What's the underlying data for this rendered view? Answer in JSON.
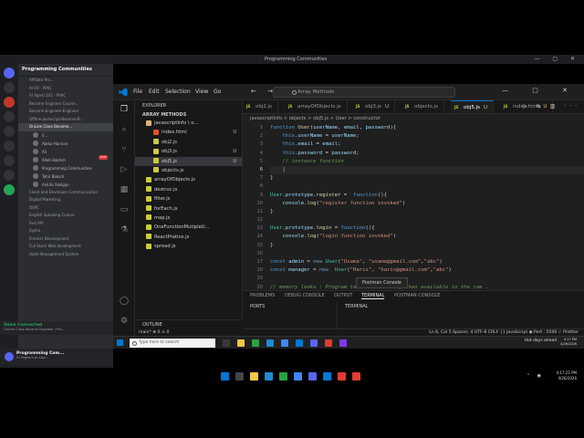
{
  "discord": {
    "window_title": "Programming Communities",
    "server_name": "Programming Communities",
    "channels": [
      "Affiliate Pro...",
      "AI IOI - PIAIC",
      "AI Agent 201 - PIAIC",
      "Become Engineer Course...",
      "Become-Engineer-Engineer",
      "Offline-javascript-Become-B...",
      "OnLine Class Become..."
    ],
    "users": [
      "S...",
      "Abdul Hannan",
      "Ali",
      "Allah Bakhsh",
      "Programming Communities",
      "Tahir Baloch",
      "Ankita Sloligan"
    ],
    "live_label": "LIVE",
    "more_channels": [
      "Client and Developer Communication",
      "Digital Marketing",
      "DSPC",
      "English Speaking Course",
      "Fast API",
      "Figma",
      "Frontier Development",
      "Full Stack Web development",
      "Hotel Management System"
    ],
    "voice_status": "Voice Connected",
    "voice_channel": "OnLine Class Become Engineer / Pro...",
    "me_name": "Programming Com...",
    "me_status": "Hi Pegham Jo Aisa..."
  },
  "vscode": {
    "menu": [
      "File",
      "Edit",
      "Selection",
      "View",
      "Go"
    ],
    "command_center": "Array Methods",
    "explorer_header": "EXPLORER",
    "project_name": "ARRAY METHODS",
    "files": [
      {
        "name": "javascriptInfo \\ o...",
        "mark": "",
        "indent": 1,
        "color": "#dcb67a"
      },
      {
        "name": "index.html",
        "mark": "U",
        "indent": 2,
        "color": "#e44d26"
      },
      {
        "name": "obj2.js",
        "mark": "",
        "indent": 2,
        "color": "#cbcb41"
      },
      {
        "name": "obj3.js",
        "mark": "U",
        "indent": 2,
        "color": "#cbcb41"
      },
      {
        "name": "obj5.js",
        "mark": "U",
        "indent": 2,
        "color": "#cbcb41"
      },
      {
        "name": "objects.js",
        "mark": "",
        "indent": 2,
        "color": "#cbcb41"
      },
      {
        "name": "arrayOfObjects.js",
        "mark": "",
        "indent": 1,
        "color": "#cbcb41"
      },
      {
        "name": "destruc.js",
        "mark": "",
        "indent": 1,
        "color": "#cbcb41"
      },
      {
        "name": "filter.js",
        "mark": "",
        "indent": 1,
        "color": "#cbcb41"
      },
      {
        "name": "forEach.js",
        "mark": "",
        "indent": 1,
        "color": "#cbcb41"
      },
      {
        "name": "map.js",
        "mark": "",
        "indent": 1,
        "color": "#cbcb41"
      },
      {
        "name": "OneFunctionMutipleU...",
        "mark": "",
        "indent": 1,
        "color": "#cbcb41"
      },
      {
        "name": "ReactPratice.js",
        "mark": "",
        "indent": 1,
        "color": "#cbcb41"
      },
      {
        "name": "spread.js",
        "mark": "",
        "indent": 1,
        "color": "#cbcb41"
      }
    ],
    "outline_label": "OUTLINE",
    "tabs": [
      {
        "label": "obj2.js",
        "mark": ""
      },
      {
        "label": "arrayOfObjects.js",
        "mark": ""
      },
      {
        "label": "obj3.js",
        "mark": "U"
      },
      {
        "label": "objects.js",
        "mark": ""
      },
      {
        "label": "obj5.js",
        "mark": "U"
      },
      {
        "label": "index.html",
        "mark": "U"
      }
    ],
    "breadcrumb": "javascriptInfo  >  objects  >  obj5.js  >  User  >  constructor",
    "line_numbers": [
      "1",
      "2",
      "3",
      "4",
      "5",
      "6",
      "7",
      "8",
      "9",
      "10",
      "11",
      "12",
      "13",
      "14",
      "15",
      "16",
      "17",
      "18",
      "19",
      "20"
    ],
    "current_line": "6",
    "code": [
      "function User(userName, email, password){",
      "    this.userName = userName;",
      "    this.email = email;",
      "    this.password = password;",
      "    // instance function",
      "    |",
      "}",
      "",
      "User.prototype.register =  function(){",
      "    console.log(\"register function invoked\")",
      "}",
      "",
      "User.prototype.login = function(){",
      "    console.log(\"login function invoked\")",
      "}",
      "",
      "const admin = new User(\"Usama\", \"usama@gmail.com\",\"abc\")",
      "const manager = new  User(\"Haris\", \"haris@gmail.com\",\"abc\")",
      "",
      "// memory leaks : Program takes more memory than available in the ram ."
    ],
    "tooltip": "Postman Console",
    "panel_tabs": [
      "PROBLEMS",
      "DEBUG CONSOLE",
      "OUTPUT",
      "TERMINAL",
      "POSTMAN CONSOLE"
    ],
    "active_panel_tab": "TERMINAL",
    "ports_label": "PORTS",
    "terminal_label": "TERMINAL",
    "status_left": "main*   ⊗ 0 ⚠ 0",
    "status_right": "Ln 6, Col 5   Spaces: 4   UTF-8   CRLF   {} JavaScript   ◉ Port : 5500   ✓ Prettier"
  },
  "inner_taskbar": {
    "search_placeholder": "Type here to search",
    "weather": "Hot days ahead",
    "time": "4:17 PM",
    "date": "4/26/2026"
  },
  "outer_taskbar": {
    "time": "4:17:21 PM",
    "date": "4/26/2026"
  },
  "colors": {
    "vscode_accent": "#0078d4",
    "discord_brand": "#5865f2"
  }
}
